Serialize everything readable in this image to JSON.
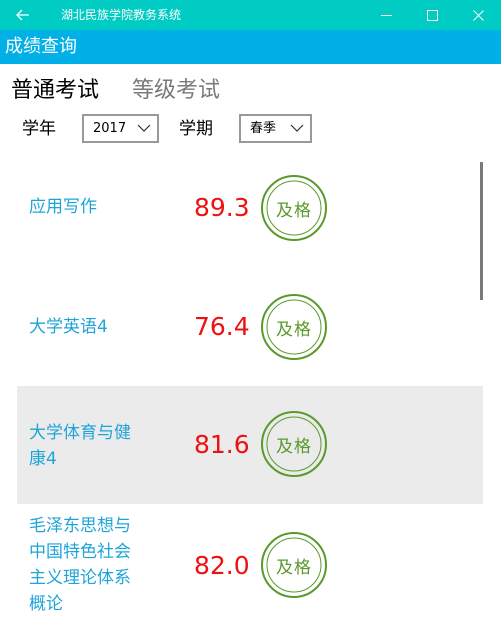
{
  "window": {
    "title": "湖北民族学院教务系统",
    "back_icon": "back-arrow-icon",
    "controls": [
      "minimize-icon",
      "maximize-icon",
      "close-icon"
    ]
  },
  "header": {
    "title": "成绩查询",
    "color": "#00b0e6"
  },
  "tabs": [
    {
      "label": "普通考试",
      "active": true
    },
    {
      "label": "等级考试",
      "active": false
    }
  ],
  "filters": {
    "year_label": "学年",
    "year_value": "2017",
    "term_label": "学期",
    "term_value": "春季"
  },
  "grades": [
    {
      "course": "应用写作",
      "score": "89.3",
      "status": "及格"
    },
    {
      "course": "大学英语4",
      "score": "76.4",
      "status": "及格"
    },
    {
      "course": "大学体育与健康4",
      "score": "81.6",
      "status": "及格",
      "selected": true
    },
    {
      "course": "毛泽东思想与中国特色社会主义理论体系概论",
      "score": "82.0",
      "status": "及格"
    }
  ],
  "colors": {
    "titlebar": "#00ccc3",
    "course_text": "#1fa4d9",
    "score_text": "#ee1111",
    "stamp": "#5a9a2c"
  }
}
